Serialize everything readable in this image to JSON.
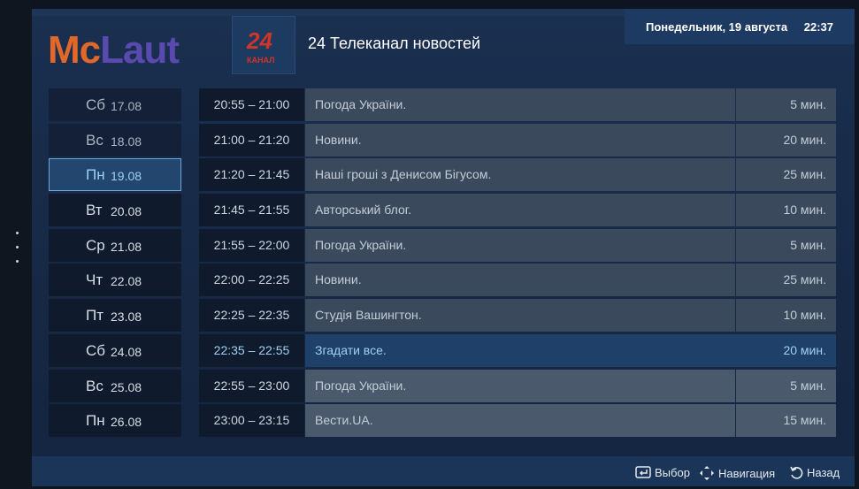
{
  "brand": {
    "logo_part1": "Mc",
    "logo_part2": "Laut"
  },
  "channel": {
    "logo_number": "24",
    "logo_sub": "КАНАЛ",
    "name": "24 Телеканал новостей"
  },
  "header": {
    "date": "Понедельник, 19 августа",
    "time": "22:37"
  },
  "days": [
    {
      "name": "Сб",
      "date": "17.08",
      "state": "past"
    },
    {
      "name": "Вс",
      "date": "18.08",
      "state": "past"
    },
    {
      "name": "Пн",
      "date": "19.08",
      "state": "selected"
    },
    {
      "name": "Вт",
      "date": "20.08",
      "state": "future"
    },
    {
      "name": "Ср",
      "date": "21.08",
      "state": "future"
    },
    {
      "name": "Чт",
      "date": "22.08",
      "state": "future"
    },
    {
      "name": "Пт",
      "date": "23.08",
      "state": "future"
    },
    {
      "name": "Сб",
      "date": "24.08",
      "state": "future"
    },
    {
      "name": "Вс",
      "date": "25.08",
      "state": "future"
    },
    {
      "name": "Пн",
      "date": "26.08",
      "state": "future"
    }
  ],
  "programs": [
    {
      "time": "20:55 – 21:00",
      "title": "Погода України.",
      "duration": "5 мин.",
      "state": "past"
    },
    {
      "time": "21:00 – 21:20",
      "title": "Новини.",
      "duration": "20 мин.",
      "state": "past"
    },
    {
      "time": "21:20 – 21:45",
      "title": "Наші гроші з Денисом Бігусом.",
      "duration": "25 мин.",
      "state": "past"
    },
    {
      "time": "21:45 – 21:55",
      "title": "Авторський блог.",
      "duration": "10 мин.",
      "state": "past"
    },
    {
      "time": "21:55 – 22:00",
      "title": "Погода України.",
      "duration": "5 мин.",
      "state": "past"
    },
    {
      "time": "22:00 – 22:25",
      "title": "Новини.",
      "duration": "25 мин.",
      "state": "past"
    },
    {
      "time": "22:25 – 22:35",
      "title": "Студія Вашингтон.",
      "duration": "10 мин.",
      "state": "past"
    },
    {
      "time": "22:35 – 22:55",
      "title": "Згадати все.",
      "duration": "20 мин.",
      "state": "current"
    },
    {
      "time": "22:55 – 23:00",
      "title": "Погода України.",
      "duration": "5 мин.",
      "state": "upcoming"
    },
    {
      "time": "23:00 – 23:15",
      "title": "Вести.UA.",
      "duration": "15 мин.",
      "state": "upcoming"
    }
  ],
  "footer": {
    "select_label": "Выбор",
    "navigate_label": "Навигация",
    "back_label": "Назад",
    "icons": [
      "enter-icon",
      "dpad-icon",
      "back-arrow-icon"
    ]
  },
  "colors": {
    "accent": "#9fd0f4",
    "logo_orange": "#e2682a",
    "logo_purple": "#5a4ab0",
    "channel_red": "#d0342a"
  }
}
